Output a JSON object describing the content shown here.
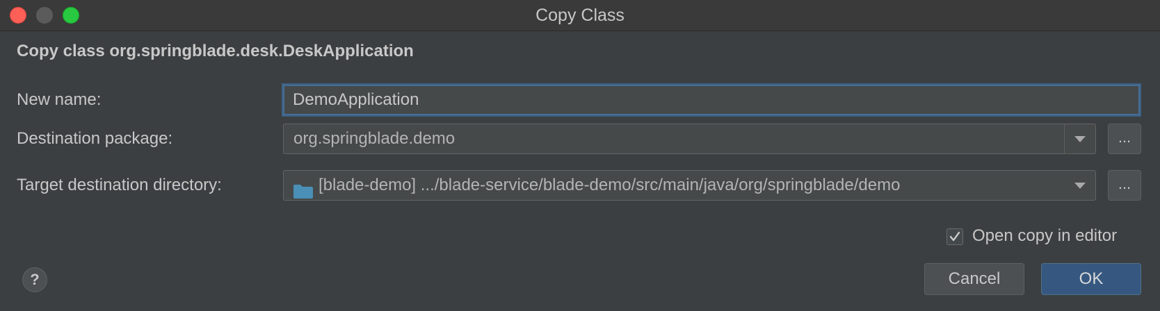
{
  "window": {
    "title": "Copy Class"
  },
  "dialog": {
    "heading": "Copy class org.springblade.desk.DeskApplication",
    "new_name": {
      "label": "New name:",
      "value": "DemoApplication"
    },
    "destination_package": {
      "label": "Destination package:",
      "value": "org.springblade.demo",
      "browse_label": "..."
    },
    "target_directory": {
      "label": "Target destination directory:",
      "value": "[blade-demo] .../blade-service/blade-demo/src/main/java/org/springblade/demo",
      "browse_label": "..."
    },
    "open_in_editor": {
      "label": "Open copy in editor",
      "checked": true
    },
    "help_label": "?",
    "cancel_label": "Cancel",
    "ok_label": "OK"
  },
  "colors": {
    "background": "#3c3f41",
    "accent": "#365880",
    "folder": "#4a8fb5"
  }
}
